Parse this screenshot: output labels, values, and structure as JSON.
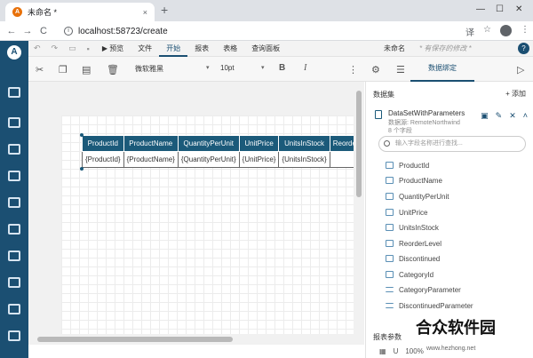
{
  "browser": {
    "tab_title": "未命名 *",
    "tab_close": "×",
    "new_tab": "+",
    "win_min": "—",
    "win_max": "☐",
    "win_close": "✕",
    "back": "←",
    "forward": "→",
    "reload": "C",
    "url": "localhost:58723/create",
    "info_glyph": "i",
    "translate_icon": "译",
    "star_icon": "☆",
    "menu_icon": "⋮"
  },
  "menubar": {
    "preview": "▶ 预览",
    "file": "文件",
    "start": "开始",
    "report": "报表",
    "table": "表格",
    "query_panel": "查询面板",
    "doc_name": "未命名",
    "unsaved": "* 有保存的修改 *",
    "help": "?"
  },
  "toolbar": {
    "font_name": "微软雅黑",
    "font_size": "10pt",
    "bold": "B",
    "italic": "I",
    "data_binding": "数据绑定",
    "more": "⋮",
    "caret": "▾"
  },
  "table": {
    "headers": [
      "ProductId",
      "ProductName",
      "QuantityPerUnit",
      "UnitPrice",
      "UnitsInStock",
      "Reorde"
    ],
    "cells": [
      "{ProductId}",
      "{ProductName}",
      "{QuantityPerUnit}",
      "{UnitPrice}",
      "{UnitsInStock}",
      ""
    ]
  },
  "panel": {
    "title": "数据集",
    "add": "+ 添加",
    "dataset_name": "DataSetWithParameters",
    "dataset_source": "数据源: RemoteNorthwind",
    "dataset_count": "8 个字段",
    "search_placeholder": "输入字段名称进行查找...",
    "fields": [
      "ProductId",
      "ProductName",
      "QuantityPerUnit",
      "UnitPrice",
      "UnitsInStock",
      "ReorderLevel",
      "Discontinued",
      "CategoryId",
      "CategoryParameter",
      "DiscontinuedParameter"
    ],
    "params_title": "报表参数"
  },
  "status": {
    "grid_icon": "▦",
    "magnet": "U",
    "zoom": "100%"
  },
  "watermark": {
    "brand": "合众软件园",
    "url": "www.hezhong.net"
  },
  "colors": {
    "accent": "#1b4f72",
    "header_bg": "#1b5a7a"
  }
}
